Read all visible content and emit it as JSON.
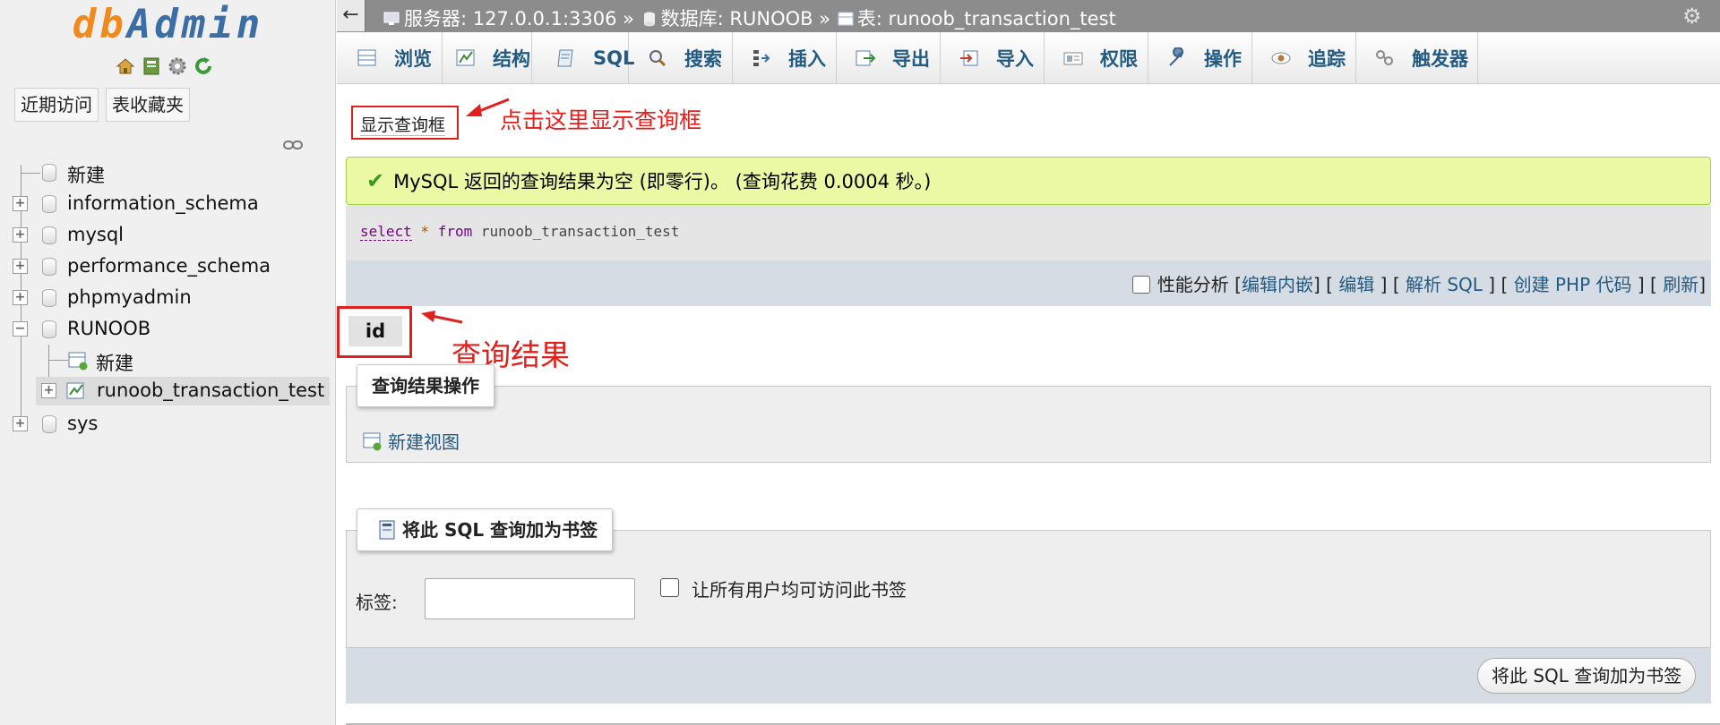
{
  "sidebar": {
    "logo": {
      "part1": "db",
      "part2": "Admin"
    },
    "logo_icons": [
      "home-icon",
      "sql-window-icon",
      "settings-icon",
      "reload-icon"
    ],
    "buttons": {
      "recent": "近期访问",
      "favorites": "表收藏夹"
    },
    "tree": {
      "new_top": "新建",
      "databases": [
        "information_schema",
        "mysql",
        "performance_schema",
        "phpmyadmin",
        "RUNOOB"
      ],
      "runoob_new": "新建",
      "runoob_table": "runoob_transaction_test",
      "last_db": "sys"
    }
  },
  "topbar": {
    "back": "←",
    "server_label": "服务器: 127.0.0.1:3306",
    "sep1": " » ",
    "db_label": "数据库: RUNOOB",
    "sep2": " » ",
    "table_label": "表: runoob_transaction_test"
  },
  "tabs": [
    {
      "label": "浏览",
      "icon": "browse-icon"
    },
    {
      "label": "结构",
      "icon": "structure-icon"
    },
    {
      "label": "SQL",
      "icon": "sql-icon"
    },
    {
      "label": "搜索",
      "icon": "search-icon"
    },
    {
      "label": "插入",
      "icon": "insert-icon"
    },
    {
      "label": "导出",
      "icon": "export-icon"
    },
    {
      "label": "导入",
      "icon": "import-icon"
    },
    {
      "label": "权限",
      "icon": "privileges-icon"
    },
    {
      "label": "操作",
      "icon": "wrench-icon"
    },
    {
      "label": "追踪",
      "icon": "eye-icon"
    },
    {
      "label": "触发器",
      "icon": "triggers-icon"
    }
  ],
  "main": {
    "show_query_box": "显示查询框",
    "annotation_show": "点击这里显示查询框",
    "success_message": "MySQL 返回的查询结果为空 (即零行)。 (查询花费 0.0004 秒。)",
    "sql": {
      "kw1": "select",
      "star": " * ",
      "kw2": "from",
      "rest": " runoob_transaction_test"
    },
    "links": {
      "profiling": "性能分析",
      "edit_inline": "编辑内嵌",
      "edit": "编辑",
      "explain": "解析 SQL",
      "create_php": "创建 PHP 代码",
      "refresh": "刷新"
    },
    "result_column": "id",
    "annotation_result": "查询结果",
    "result_ops_legend": "查询结果操作",
    "new_view": "新建视图",
    "bookmark_legend": "将此 SQL 查询加为书签",
    "bookmark_label": "标签:",
    "bookmark_share": "让所有用户均可访问此书签",
    "bookmark_submit": "将此 SQL 查询加为书签"
  },
  "colors": {
    "annotation_red": "#e0201d",
    "link_blue": "#235a81",
    "success_bg": "#ebf8a4",
    "logo_orange": "#f08a1c",
    "logo_blue": "#3a6ea5"
  }
}
